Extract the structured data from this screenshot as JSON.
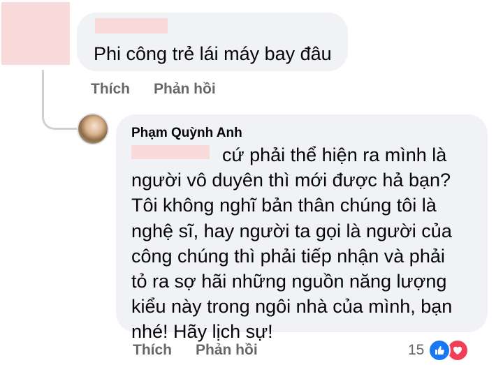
{
  "comment_1": {
    "text": "Phi công trẻ lái máy bay đâu",
    "actions": {
      "like": "Thích",
      "reply": "Phản hồi"
    }
  },
  "comment_2": {
    "author": "Phạm Quỳnh Anh",
    "text": "cứ phải thể hiện ra mình là người vô duyên thì mới được hả bạn? Tôi không nghĩ bản thân chúng tôi là nghệ sĩ, hay người ta gọi là người của công chúng thì phải tiếp nhận và phải tỏ ra sợ hãi những nguồn năng lượng kiểu này trong ngôi nhà của mình, bạn nhé! Hãy lịch sự!",
    "actions": {
      "like": "Thích",
      "reply": "Phản hồi"
    },
    "reactions": {
      "count": "15",
      "icons": [
        "like-icon",
        "love-icon"
      ],
      "colors": {
        "like": "#1877f2",
        "love": "#f33e58"
      }
    }
  },
  "colors": {
    "bubble": "#f0f2f5",
    "action_text": "#65676b",
    "redaction": "#f9dada"
  }
}
